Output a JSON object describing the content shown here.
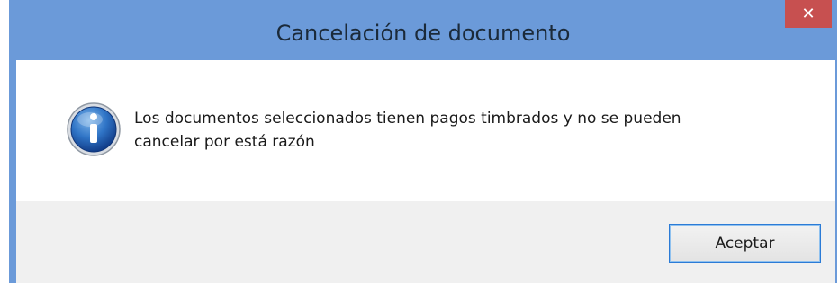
{
  "dialog": {
    "title": "Cancelación de documento",
    "close_glyph": "✕",
    "icon": "information-icon",
    "message_line1": "Los documentos seleccionados tienen pagos timbrados y no se pueden",
    "message_line2": "cancelar por está razón",
    "ok_label": "Aceptar"
  },
  "colors": {
    "titlebar": "#6b9ad9",
    "close_button": "#c75050",
    "footer": "#f0f0f0",
    "button_focus_border": "#2b7bd6"
  }
}
